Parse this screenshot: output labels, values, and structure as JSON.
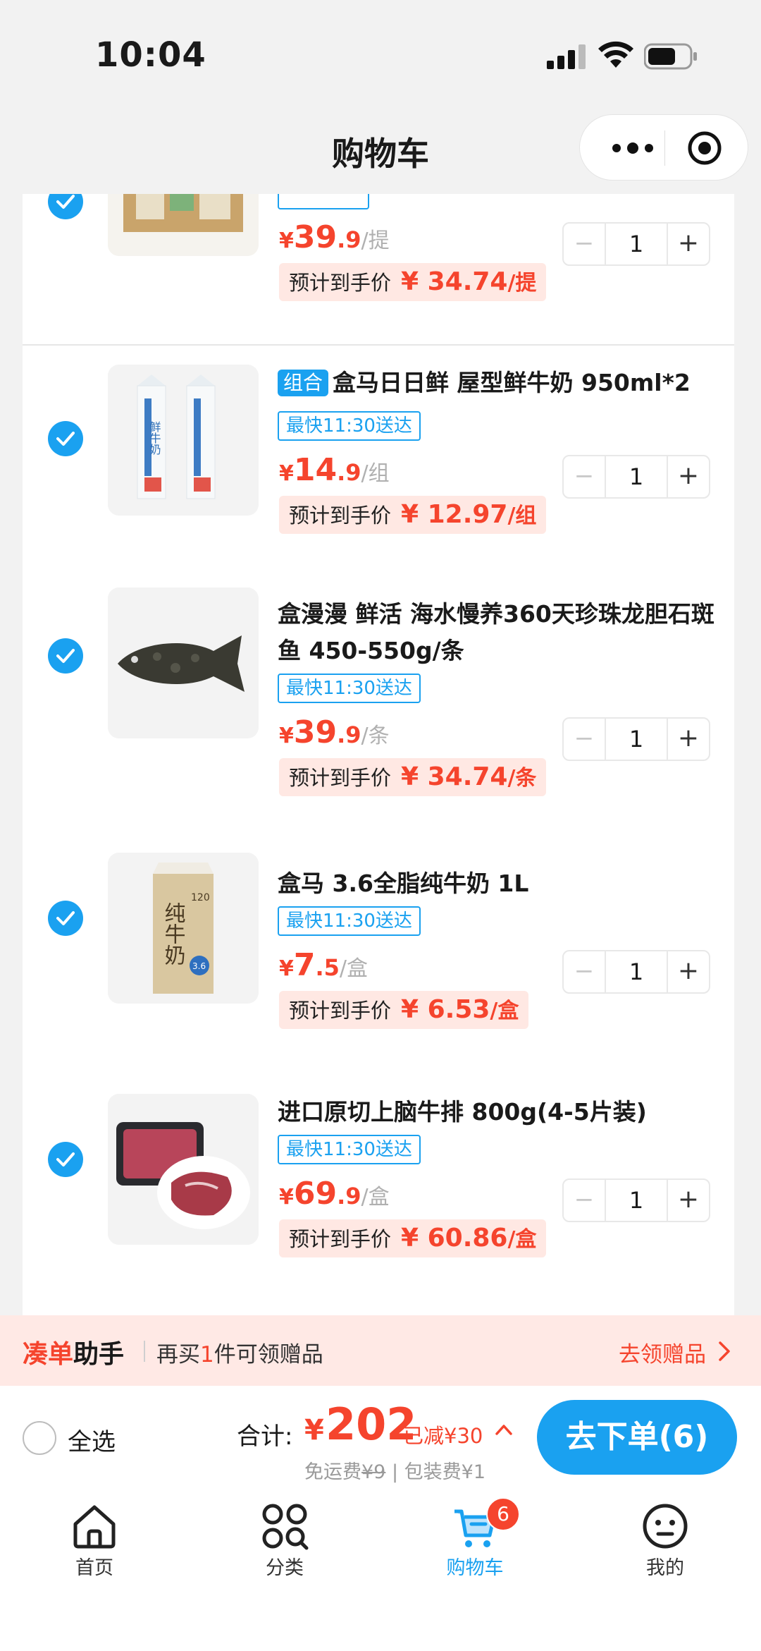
{
  "status_bar": {
    "time": "10:04"
  },
  "nav": {
    "title": "购物车"
  },
  "items": [
    {
      "name": "",
      "combo_tag": "",
      "delivery": "",
      "price": {
        "yen": "¥",
        "int": "39",
        "dec": ".9",
        "unit": "/提"
      },
      "qty": "1",
      "est": {
        "label": "预计到手价",
        "value": "¥ 34.74",
        "unit": "/提"
      }
    },
    {
      "name": "盒马日日鲜 屋型鲜牛奶 950ml*2",
      "combo_tag": "组合",
      "delivery": "最快11:30送达",
      "price": {
        "yen": "¥",
        "int": "14",
        "dec": ".9",
        "unit": "/组"
      },
      "qty": "1",
      "est": {
        "label": "预计到手价",
        "value": "¥ 12.97",
        "unit": "/组"
      }
    },
    {
      "name": "盒漫漫 鲜活 海水慢养360天珍珠龙胆石斑鱼 450-550g/条",
      "combo_tag": "",
      "delivery": "最快11:30送达",
      "price": {
        "yen": "¥",
        "int": "39",
        "dec": ".9",
        "unit": "/条"
      },
      "qty": "1",
      "est": {
        "label": "预计到手价",
        "value": "¥ 34.74",
        "unit": "/条"
      }
    },
    {
      "name": "盒马 3.6全脂纯牛奶 1L",
      "combo_tag": "",
      "delivery": "最快11:30送达",
      "price": {
        "yen": "¥",
        "int": "7",
        "dec": ".5",
        "unit": "/盒"
      },
      "qty": "1",
      "est": {
        "label": "预计到手价",
        "value": "¥ 6.53",
        "unit": "/盒"
      }
    },
    {
      "name": "进口原切上脑牛排 800g(4-5片装)",
      "combo_tag": "",
      "delivery": "最快11:30送达",
      "price": {
        "yen": "¥",
        "int": "69",
        "dec": ".9",
        "unit": "/盒"
      },
      "qty": "1",
      "est": {
        "label": "预计到手价",
        "value": "¥ 60.86",
        "unit": "/盒"
      }
    }
  ],
  "milk_box": {
    "main": "纯牛奶",
    "badge_top": "120",
    "badge_bottom": "3.6"
  },
  "milk_carton": {
    "text": "鲜牛奶"
  },
  "helper": {
    "brand_red": "凑单",
    "brand_black": "助手",
    "msg_pre": "再买",
    "msg_num": "1",
    "msg_post": "件可领赠品",
    "action": "去领赠品"
  },
  "checkout": {
    "select_all": "全选",
    "total_label": "合计:",
    "total_yen": "¥",
    "total_value": "202",
    "discount": "已减¥30",
    "fee_free_label": "免运费",
    "fee_free_struck": "¥9",
    "fee_sep": "|",
    "fee_pack": "包装费¥1",
    "order_button": "去下单(6)"
  },
  "tabs": [
    {
      "label": "首页",
      "icon": "home-icon"
    },
    {
      "label": "分类",
      "icon": "category-icon"
    },
    {
      "label": "购物车",
      "icon": "cart-icon",
      "badge": "6"
    },
    {
      "label": "我的",
      "icon": "profile-icon"
    }
  ],
  "colors": {
    "accent": "#1aa1f0",
    "price": "#f5442d",
    "est_bg": "#ffe8e3"
  }
}
